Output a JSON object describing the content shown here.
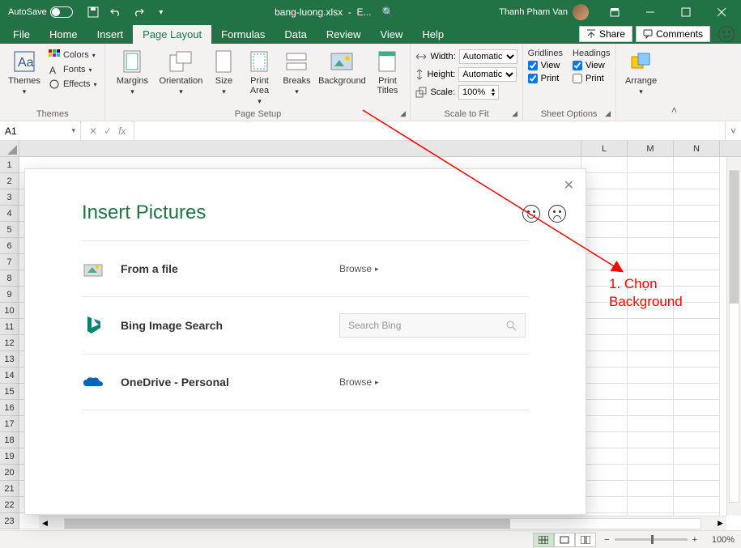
{
  "titlebar": {
    "autosave_label": "AutoSave",
    "autosave_state": "Off",
    "filename": "bang-luong.xlsx",
    "app": "E...",
    "user": "Thanh Pham Van"
  },
  "tabs": {
    "file": "File",
    "home": "Home",
    "insert": "Insert",
    "page_layout": "Page Layout",
    "formulas": "Formulas",
    "data": "Data",
    "review": "Review",
    "view": "View",
    "help": "Help",
    "share": "Share",
    "comments": "Comments"
  },
  "ribbon": {
    "themes": {
      "themes": "Themes",
      "colors": "Colors",
      "fonts": "Fonts",
      "effects": "Effects",
      "group": "Themes"
    },
    "page_setup": {
      "margins": "Margins",
      "orientation": "Orientation",
      "size": "Size",
      "print_area": "Print Area",
      "breaks": "Breaks",
      "background": "Background",
      "print_titles": "Print Titles",
      "group": "Page Setup"
    },
    "scale": {
      "width": "Width:",
      "width_val": "Automatic",
      "height": "Height:",
      "height_val": "Automatic",
      "scale": "Scale:",
      "scale_val": "100%",
      "group": "Scale to Fit"
    },
    "sheet_options": {
      "gridlines": "Gridlines",
      "headings": "Headings",
      "view": "View",
      "print": "Print",
      "group": "Sheet Options"
    },
    "arrange": {
      "arrange": "Arrange",
      "group": "Arrange"
    }
  },
  "formula_bar": {
    "namebox": "A1",
    "formula": ""
  },
  "columns": [
    "L",
    "M",
    "N"
  ],
  "rows_visible": 23,
  "dialog": {
    "title": "Insert Pictures",
    "items": [
      {
        "label": "From a file",
        "action": "Browse",
        "icon": "file"
      },
      {
        "label": "Bing Image Search",
        "action_placeholder": "Search Bing",
        "icon": "bing"
      },
      {
        "label": "OneDrive - Personal",
        "action": "Browse",
        "icon": "onedrive"
      }
    ]
  },
  "annotation": {
    "line1": "1. Chọn",
    "line2": "Background"
  },
  "statusbar": {
    "zoom": "100%"
  }
}
